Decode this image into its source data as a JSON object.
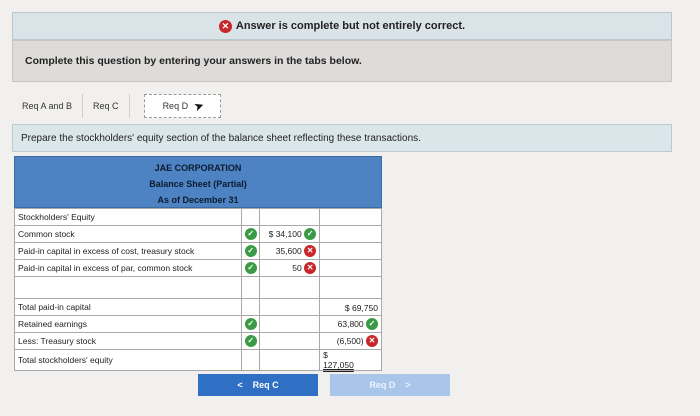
{
  "status": {
    "icon": "x-circle-icon",
    "text": "Answer is complete but not entirely correct."
  },
  "instruction": "Complete this question by entering your answers in the tabs below.",
  "tabs": [
    {
      "label": "Req A and B"
    },
    {
      "label": "Req C"
    },
    {
      "label": "Req D",
      "active": true
    }
  ],
  "prompt": "Prepare the stockholders' equity section of the balance sheet reflecting these transactions.",
  "sheet": {
    "company": "JAE CORPORATION",
    "title": "Balance Sheet (Partial)",
    "date": "As of December 31",
    "section_label": "Stockholders' Equity",
    "rows": {
      "common_stock": {
        "label": "Common stock",
        "value": "$ 34,100"
      },
      "pic_treasury": {
        "label": "Paid-in capital in excess of cost, treasury stock",
        "value": "35,600"
      },
      "pic_par": {
        "label": "Paid-in capital in excess of par, common stock",
        "value": "50"
      },
      "total_pic": {
        "label": "Total paid-in capital",
        "value": "$ 69,750"
      },
      "retained": {
        "label": "Retained earnings",
        "value": "63,800"
      },
      "treasury": {
        "label": "Less: Treasury stock",
        "value": "(6,500)"
      },
      "total_se": {
        "label": "Total stockholders' equity",
        "prefix": "$",
        "value": "127,050"
      }
    }
  },
  "nav": {
    "prev_label": "Req C",
    "next_label": "Req D",
    "prev_arrow": "<",
    "next_arrow": ">"
  },
  "colors": {
    "correct": "#3a9a45",
    "incorrect": "#c8262b",
    "header_blue": "#4d82c3"
  }
}
